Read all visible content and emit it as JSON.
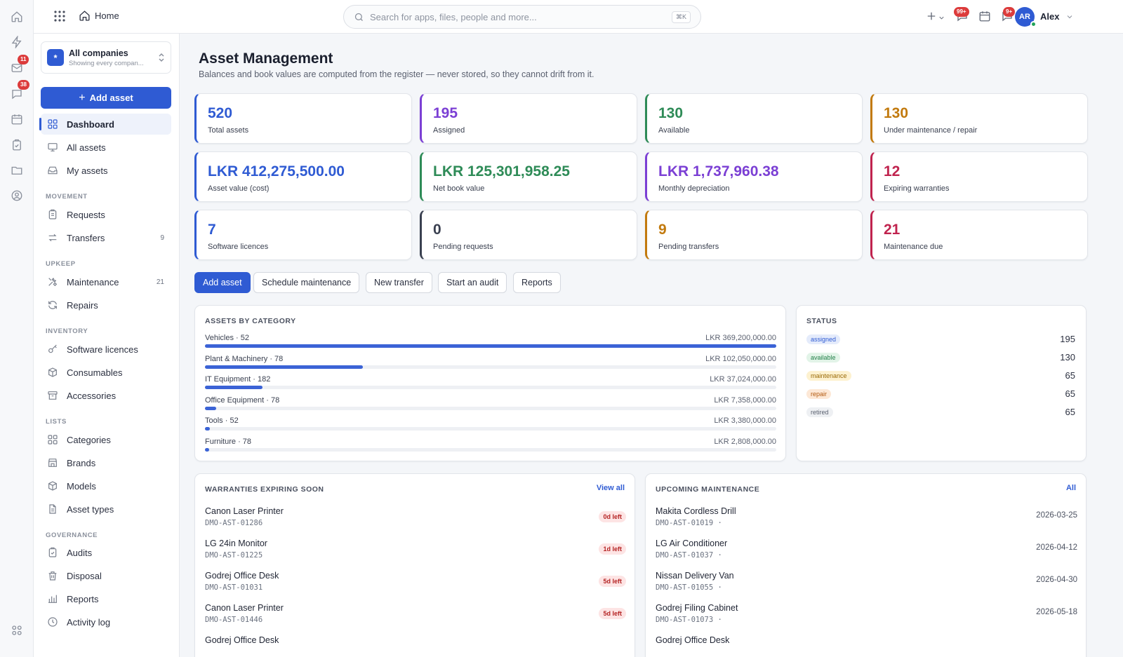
{
  "rail": {
    "mail_badge": "11",
    "chat_badge": "38"
  },
  "topbar": {
    "home_label": "Home",
    "search_placeholder": "Search for apps, files, people and more...",
    "search_shortcut": "⌘K",
    "notifications_badge": "99+",
    "alerts_badge": "9+",
    "user_initials": "AR",
    "user_name": "Alex"
  },
  "sidebar": {
    "company_name": "All companies",
    "company_sub": "Showing every compan...",
    "company_logo": "*",
    "add_asset_label": "Add asset",
    "top_items": [
      {
        "label": "Dashboard"
      },
      {
        "label": "All assets"
      },
      {
        "label": "My assets"
      }
    ],
    "sections": {
      "movement": "MOVEMENT",
      "upkeep": "UPKEEP",
      "inventory": "INVENTORY",
      "lists": "LISTS",
      "governance": "GOVERNANCE"
    },
    "movement_items": [
      {
        "label": "Requests",
        "count": ""
      },
      {
        "label": "Transfers",
        "count": "9"
      }
    ],
    "upkeep_items": [
      {
        "label": "Maintenance",
        "count": "21"
      },
      {
        "label": "Repairs",
        "count": ""
      }
    ],
    "inventory_items": [
      {
        "label": "Software licences"
      },
      {
        "label": "Consumables"
      },
      {
        "label": "Accessories"
      }
    ],
    "lists_items": [
      {
        "label": "Categories"
      },
      {
        "label": "Brands"
      },
      {
        "label": "Models"
      },
      {
        "label": "Asset types"
      }
    ],
    "governance_items": [
      {
        "label": "Audits"
      },
      {
        "label": "Disposal"
      },
      {
        "label": "Reports"
      },
      {
        "label": "Activity log"
      }
    ]
  },
  "page": {
    "title": "Asset Management",
    "subtitle": "Balances and book values are computed from the register — never stored, so they cannot drift from it."
  },
  "stats": [
    {
      "value": "520",
      "label": "Total assets",
      "color": "#2f5bd3"
    },
    {
      "value": "195",
      "label": "Assigned",
      "color": "#7b3fd4"
    },
    {
      "value": "130",
      "label": "Available",
      "color": "#2e8b57"
    },
    {
      "value": "130",
      "label": "Under maintenance / repair",
      "color": "#c27a0e"
    },
    {
      "value": "LKR 412,275,500.00",
      "label": "Asset value (cost)",
      "color": "#2f5bd3"
    },
    {
      "value": "LKR 125,301,958.25",
      "label": "Net book value",
      "color": "#2e8b57"
    },
    {
      "value": "LKR 1,737,960.38",
      "label": "Monthly depreciation",
      "color": "#7b3fd4"
    },
    {
      "value": "12",
      "label": "Expiring warranties",
      "color": "#c0234e"
    },
    {
      "value": "7",
      "label": "Software licences",
      "color": "#2f5bd3"
    },
    {
      "value": "0",
      "label": "Pending requests",
      "color": "#3a4050"
    },
    {
      "value": "9",
      "label": "Pending transfers",
      "color": "#c27a0e"
    },
    {
      "value": "21",
      "label": "Maintenance due",
      "color": "#c0234e"
    }
  ],
  "actions": {
    "add_asset": "Add asset",
    "schedule_maintenance": "Schedule maintenance",
    "new_transfer": "New transfer",
    "start_audit": "Start an audit",
    "reports": "Reports"
  },
  "categories_card": {
    "title": "ASSETS BY CATEGORY",
    "rows": [
      {
        "label": "Vehicles · 52",
        "amount": "LKR 369,200,000.00",
        "value": 369200000
      },
      {
        "label": "Plant & Machinery · 78",
        "amount": "LKR 102,050,000.00",
        "value": 102050000
      },
      {
        "label": "IT Equipment · 182",
        "amount": "LKR 37,024,000.00",
        "value": 37024000
      },
      {
        "label": "Office Equipment · 78",
        "amount": "LKR 7,358,000.00",
        "value": 7358000
      },
      {
        "label": "Tools · 52",
        "amount": "LKR 3,380,000.00",
        "value": 3380000
      },
      {
        "label": "Furniture · 78",
        "amount": "LKR 2,808,000.00",
        "value": 2808000
      }
    ]
  },
  "status_card": {
    "title": "STATUS",
    "rows": [
      {
        "label": "assigned",
        "count": "195",
        "bg": "#e4ebfb",
        "fg": "#2f5bd3"
      },
      {
        "label": "available",
        "count": "130",
        "bg": "#e2f4e8",
        "fg": "#23804a"
      },
      {
        "label": "maintenance",
        "count": "65",
        "bg": "#fdf1cf",
        "fg": "#9a6a06"
      },
      {
        "label": "repair",
        "count": "65",
        "bg": "#fde8d6",
        "fg": "#b35a12"
      },
      {
        "label": "retired",
        "count": "65",
        "bg": "#eef0f3",
        "fg": "#5b6170"
      }
    ]
  },
  "warranties_card": {
    "title": "WARRANTIES EXPIRING SOON",
    "link": "View all",
    "rows": [
      {
        "name": "Canon Laser Printer",
        "code": "DMO-AST-01286",
        "left": "0d left"
      },
      {
        "name": "LG 24in Monitor",
        "code": "DMO-AST-01225",
        "left": "1d left"
      },
      {
        "name": "Godrej Office Desk",
        "code": "DMO-AST-01031",
        "left": "5d left"
      },
      {
        "name": "Canon Laser Printer",
        "code": "DMO-AST-01446",
        "left": "5d left"
      },
      {
        "name": "Godrej Office Desk",
        "code": "",
        "left": ""
      }
    ]
  },
  "maintenance_card": {
    "title": "UPCOMING MAINTENANCE",
    "link": "All",
    "rows": [
      {
        "name": "Makita Cordless Drill",
        "code": "DMO-AST-01019 ·",
        "date": "2026-03-25"
      },
      {
        "name": "LG Air Conditioner",
        "code": "DMO-AST-01037 ·",
        "date": "2026-04-12"
      },
      {
        "name": "Nissan Delivery Van",
        "code": "DMO-AST-01055 ·",
        "date": "2026-04-30"
      },
      {
        "name": "Godrej Filing Cabinet",
        "code": "DMO-AST-01073 ·",
        "date": "2026-05-18"
      },
      {
        "name": "Godrej Office Desk",
        "code": "",
        "date": ""
      }
    ]
  }
}
